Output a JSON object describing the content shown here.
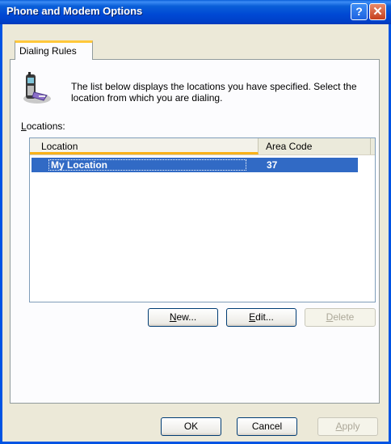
{
  "window": {
    "title": "Phone and Modem Options"
  },
  "tabs": [
    {
      "label": "Dialing Rules"
    }
  ],
  "description": "The list below displays the locations you have specified. Select the location from which you are dialing.",
  "locations_label": {
    "accel": "L",
    "rest": "ocations:"
  },
  "table": {
    "columns": [
      "Location",
      "Area Code"
    ],
    "rows": [
      {
        "location": "My Location",
        "area_code": "37",
        "selected": true
      }
    ]
  },
  "buttons": {
    "new": {
      "accel": "N",
      "rest": "ew..."
    },
    "edit": {
      "accel": "E",
      "rest": "dit..."
    },
    "delete": {
      "accel": "D",
      "rest": "elete"
    },
    "ok": "OK",
    "cancel": "Cancel",
    "apply": {
      "accel": "A",
      "rest": "pply"
    }
  },
  "icons": {
    "title_help": "help-icon",
    "title_close": "close-icon",
    "dialog": "phone-icon",
    "row": "radio-selected-icon"
  },
  "colors": {
    "titlebar": "#0a5fd8",
    "selection": "#316ac5",
    "tab_accent": "#ffc83c",
    "face": "#ece9d8"
  }
}
